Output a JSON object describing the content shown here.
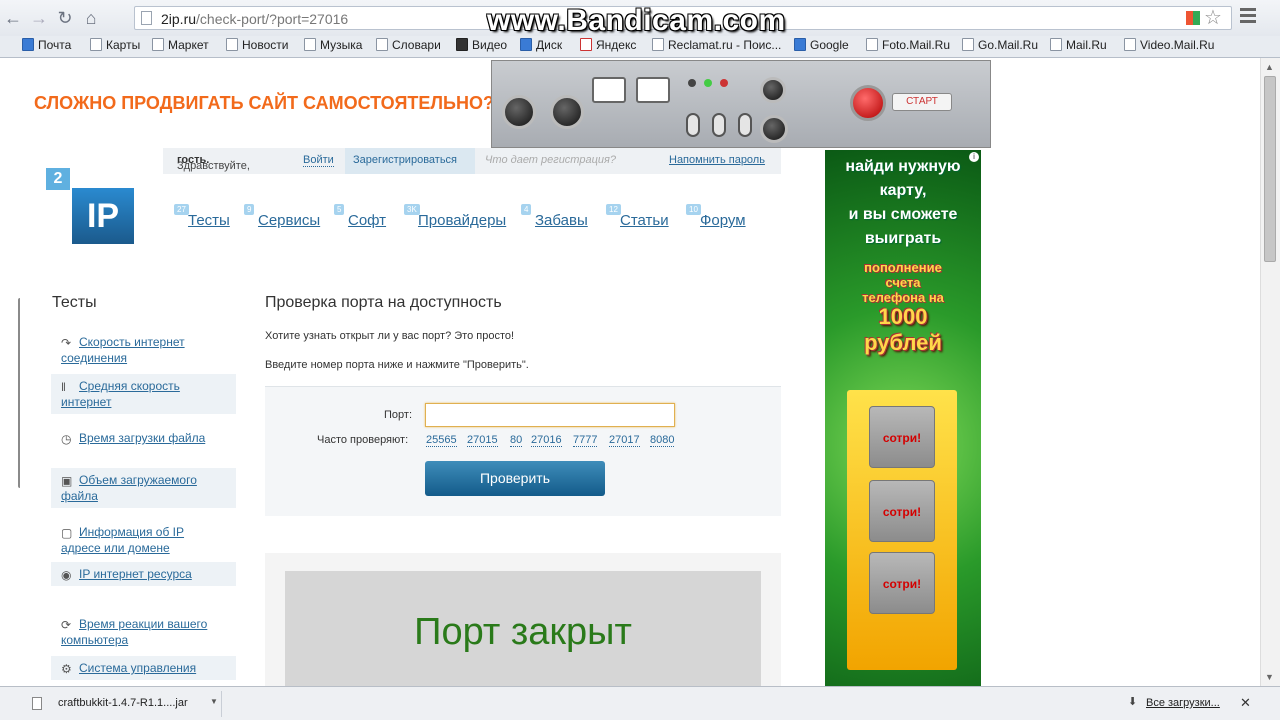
{
  "browser": {
    "url_host": "2ip.ru",
    "url_path": "/check-port/?port=27016",
    "watermark": "www.Bandicam.com"
  },
  "bookmarks": [
    {
      "label": "Почта",
      "icon": "mail-icon"
    },
    {
      "label": "Карты",
      "icon": "page-icon"
    },
    {
      "label": "Маркет",
      "icon": "page-icon"
    },
    {
      "label": "Новости",
      "icon": "page-icon"
    },
    {
      "label": "Музыка",
      "icon": "page-icon"
    },
    {
      "label": "Словари",
      "icon": "page-icon"
    },
    {
      "label": "Видео",
      "icon": "video-icon"
    },
    {
      "label": "Диск",
      "icon": "disk-icon"
    },
    {
      "label": "Яндекс",
      "icon": "yandex-icon"
    },
    {
      "label": "Reclamat.ru - Поис...",
      "icon": "arrow-icon"
    },
    {
      "label": "Google",
      "icon": "google-icon"
    },
    {
      "label": "Foto.Mail.Ru",
      "icon": "page-icon"
    },
    {
      "label": "Go.Mail.Ru",
      "icon": "page-icon"
    },
    {
      "label": "Mail.Ru",
      "icon": "page-icon"
    },
    {
      "label": "Video.Mail.Ru",
      "icon": "page-icon"
    }
  ],
  "banner": {
    "text": "СЛОЖНО ПРОДВИГАТЬ САЙТ САМОСТОЯТЕЛЬНО?",
    "start_label": "СТАРТ"
  },
  "site": {
    "greeting_prefix": "Здравствуйте, ",
    "greeting_user": "гость.",
    "login": "Войти",
    "register": "Зарегистрироваться",
    "why_register": "Что дает регистрация?",
    "remind_password": "Напомнить пароль",
    "logo_small": "2",
    "logo_big": "IP"
  },
  "nav": [
    {
      "label": "Тесты",
      "count": "27"
    },
    {
      "label": "Сервисы",
      "count": "9"
    },
    {
      "label": "Софт",
      "count": "5"
    },
    {
      "label": "Провайдеры",
      "count": "3K"
    },
    {
      "label": "Забавы",
      "count": "4"
    },
    {
      "label": "Статьи",
      "count": "12"
    },
    {
      "label": "Форум",
      "count": "10"
    }
  ],
  "sidebar": {
    "title": "Тесты",
    "items": [
      {
        "label": "Скорость интернет соединения",
        "icon": "speed-icon"
      },
      {
        "label": "Средняя скорость интернет",
        "icon": "bars-icon"
      },
      {
        "label": "Время загрузки файла",
        "icon": "clock-icon"
      },
      {
        "label": "Объем загружаемого файла",
        "icon": "monitor-icon"
      },
      {
        "label": "Информация об IP адресе или домене",
        "icon": "ip-icon"
      },
      {
        "label": "IP интернет ресурса",
        "icon": "globe-ip-icon"
      },
      {
        "label": "Время реакции вашего компьютера",
        "icon": "reaction-icon"
      },
      {
        "label": "Система управления",
        "icon": "system-icon"
      }
    ]
  },
  "main": {
    "title": "Проверка порта на доступность",
    "intro": "Хотите узнать открыт ли у вас порт? Это просто!",
    "instruction": "Введите номер порта ниже и нажмите \"Проверить\".",
    "port_label": "Порт:",
    "port_value": "",
    "frequent_label": "Часто проверяют:",
    "frequent_ports": [
      "25565",
      "27015",
      "80",
      "27016",
      "7777",
      "27017",
      "8080"
    ],
    "check_button": "Проверить",
    "result": "Порт закрыт"
  },
  "side_ad": {
    "lines": [
      "найди нужную",
      "карту,",
      "и вы сможете",
      "выиграть"
    ],
    "highlight": [
      "пополнение",
      "счета",
      "телефона на"
    ],
    "amount": "1000",
    "currency": "рублей",
    "scratch_label": "сотри!"
  },
  "downloads": {
    "file": "craftbukkit-1.4.7-R1.1....jar",
    "all_label": "Все загрузки..."
  },
  "colors": {
    "banner_text": "#f26a1b",
    "link": "#2a6a9a",
    "result_text": "#2a7a1a",
    "button": "#135b8a"
  }
}
